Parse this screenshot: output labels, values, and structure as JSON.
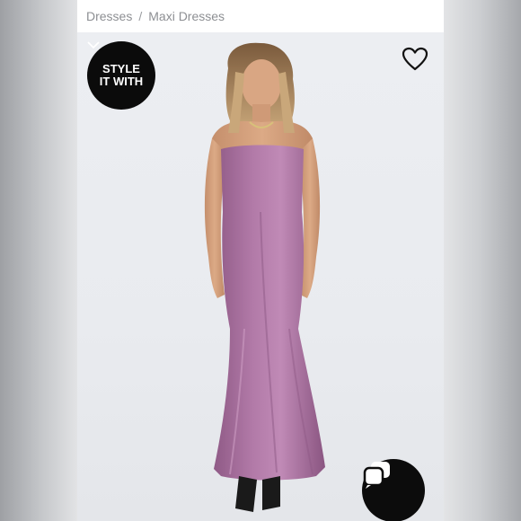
{
  "breadcrumb": {
    "items": [
      "Dresses",
      "Maxi Dresses"
    ],
    "separator": "/"
  },
  "style_badge": {
    "line1": "STYLE",
    "line2": "IT WITH",
    "icon": "chevron-down-icon"
  },
  "wishlist": {
    "icon": "heart-icon"
  },
  "chat": {
    "icon": "chat-bubbles-icon"
  },
  "product_image": {
    "dress_color": "#a9739f",
    "background": "#eceef2"
  }
}
